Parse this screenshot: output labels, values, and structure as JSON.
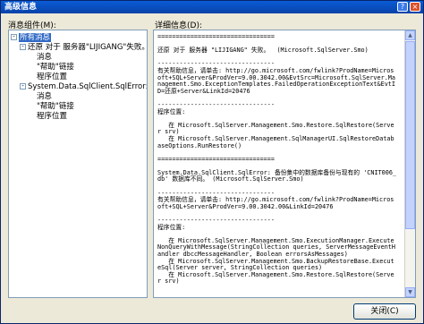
{
  "window": {
    "title": "高级信息"
  },
  "tree": {
    "header": "消息组件(M):",
    "items": [
      {
        "label": "所有消息",
        "level": 0,
        "expander": "-"
      },
      {
        "label": "还原 对于 服务器\"LIJIGANG\"失败。",
        "level": 1,
        "expander": "-"
      },
      {
        "label": "消息",
        "level": 2,
        "expander": ""
      },
      {
        "label": "\"帮助\"链接",
        "level": 2,
        "expander": ""
      },
      {
        "label": "程序位置",
        "level": 2,
        "expander": ""
      },
      {
        "label": "System.Data.SqlClient.SqlError: 备份",
        "level": 1,
        "expander": "-"
      },
      {
        "label": "消息",
        "level": 2,
        "expander": ""
      },
      {
        "label": "\"帮助\"链接",
        "level": 2,
        "expander": ""
      },
      {
        "label": "程序位置",
        "level": 2,
        "expander": ""
      }
    ]
  },
  "details": {
    "header": "详细信息(D):",
    "lines": [
      "================================",
      "",
      "还原 对于 服务器 \"LIJIGANG\" 失败。  (Microsoft.SqlServer.Smo)",
      "",
      "--------------------------------",
      "有关帮助信息，请单击: http://go.microsoft.com/fwlink?ProdName=Microsoft+SQL+Server&ProdVer=9.00.3042.00&EvtSrc=Microsoft.SqlServer.Management.Smo.ExceptionTemplates.FailedOperationExceptionText&EvtID=还原+Server&LinkId=20476",
      "",
      "--------------------------------",
      "程序位置:",
      "",
      "   在 Microsoft.SqlServer.Management.Smo.Restore.SqlRestore(Server srv)",
      "   在 Microsoft.SqlServer.Management.SqlManagerUI.SqlRestoreDatabaseOptions.RunRestore()",
      "",
      "================================",
      "",
      "System.Data.SqlClient.SqlError: 备份集中的数据库备份与现有的 'CNIT006_db' 数据库不同。 (Microsoft.SqlServer.Smo)",
      "",
      "--------------------------------",
      "有关帮助信息，请单击: http://go.microsoft.com/fwlink?ProdName=Microsoft+SQL+Server&ProdVer=9.00.3042.00&LinkId=20476",
      "",
      "--------------------------------",
      "程序位置:",
      "",
      "   在 Microsoft.SqlServer.Management.Smo.ExecutionManager.ExecuteNonQueryWithMessage(StringCollection queries, ServerMessageEventHandler dbccMessageHandler, Boolean errorsAsMessages)",
      "   在 Microsoft.SqlServer.Management.Smo.BackupRestoreBase.ExecuteSql(Server server, StringCollection queries)",
      "   在 Microsoft.SqlServer.Management.Smo.Restore.SqlRestore(Server srv)"
    ]
  },
  "buttons": {
    "close": "关闭(C)"
  }
}
